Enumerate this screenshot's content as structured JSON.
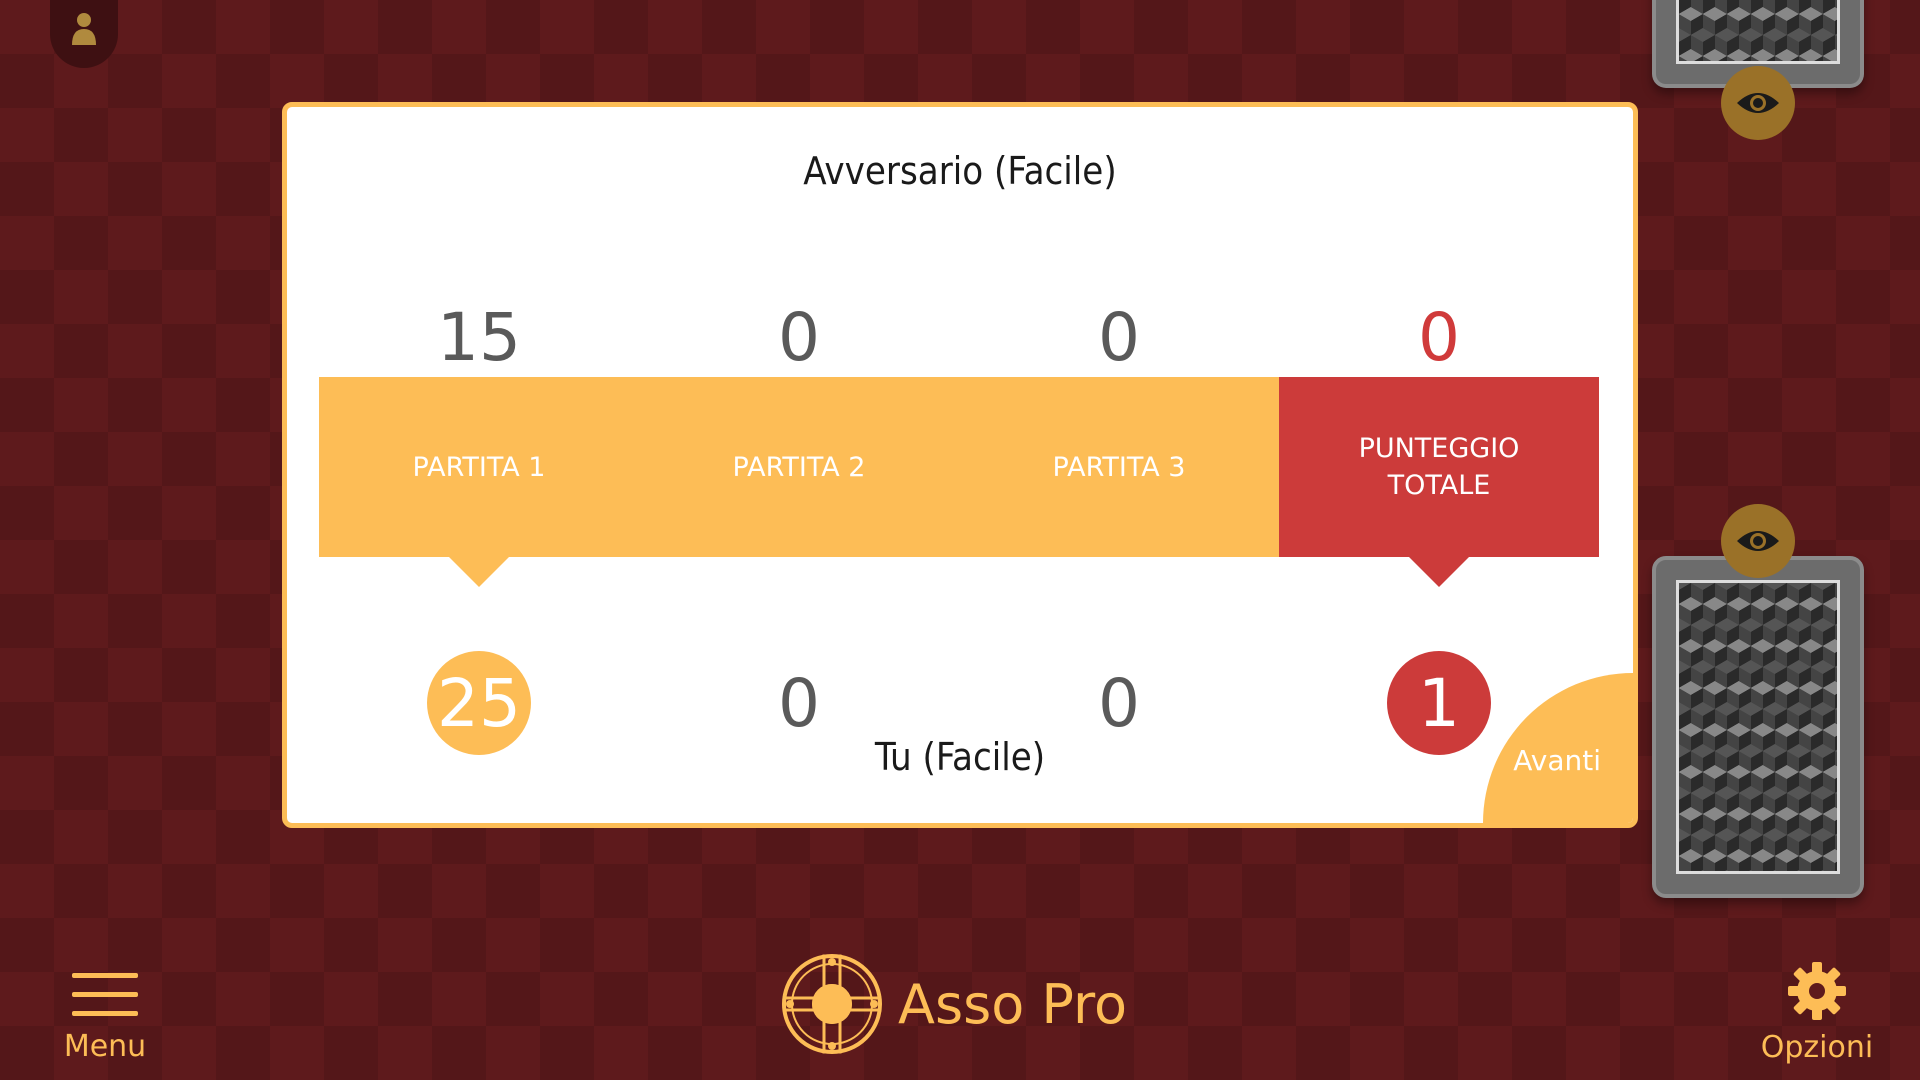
{
  "opponent": {
    "name": "Avversario (Facile)",
    "scores": [
      "15",
      "0",
      "0"
    ],
    "total": "0"
  },
  "you": {
    "name": "Tu (Facile)",
    "scores": [
      "25",
      "0",
      "0"
    ],
    "total": "1"
  },
  "headers": [
    "PARTITA 1",
    "PARTITA 2",
    "PARTITA 3",
    "PUNTEGGIO\nTOTALE"
  ],
  "next_label": "Avanti",
  "bottom_bar": {
    "menu_label": "Menu",
    "brand": "Asso Pro",
    "options_label": "Opzioni"
  },
  "colors": {
    "accent": "#fdbd56",
    "total_red": "#cc3b3a",
    "table_bg": "#5e1a1c"
  },
  "icons": [
    "avatar-icon",
    "eye-icon",
    "menu-icon",
    "brand-logo-icon",
    "gear-icon"
  ]
}
